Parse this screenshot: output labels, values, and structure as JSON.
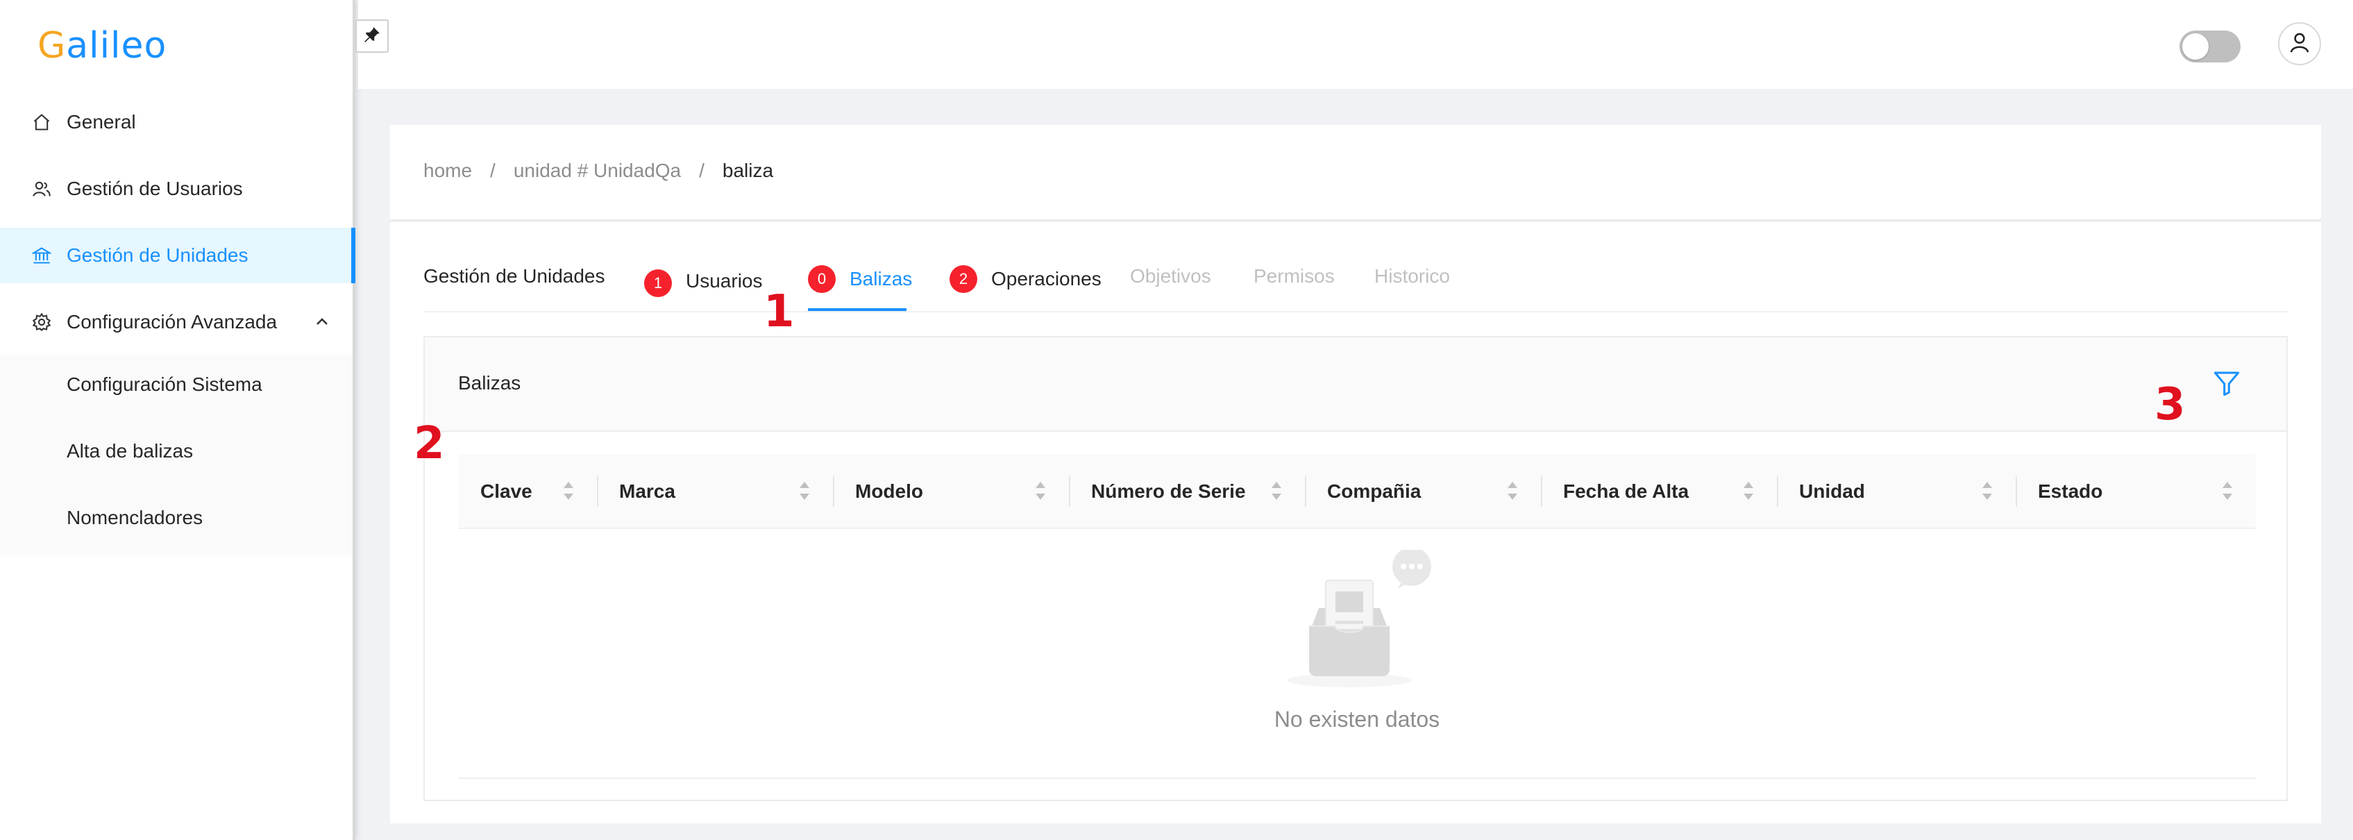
{
  "logo": {
    "first": "G",
    "rest": "alileo"
  },
  "sidebar": {
    "items": [
      {
        "label": "General",
        "icon": "home-icon"
      },
      {
        "label": "Gestión de Usuarios",
        "icon": "users-icon"
      },
      {
        "label": "Gestión de Unidades",
        "icon": "bank-icon",
        "active": true
      },
      {
        "label": "Configuración Avanzada",
        "icon": "gear-icon",
        "expanded": true
      }
    ],
    "submenu": [
      {
        "label": "Configuración Sistema"
      },
      {
        "label": "Alta de balizas"
      },
      {
        "label": "Nomencladores"
      }
    ]
  },
  "header": {
    "pin_icon": "pin-icon",
    "theme_toggle": false,
    "user_icon": "user-icon"
  },
  "breadcrumb": {
    "items": [
      "home",
      "unidad # UnidadQa",
      "baliza"
    ],
    "separator": "/"
  },
  "tabs": [
    {
      "label": "Gestión de Unidades"
    },
    {
      "label": "Usuarios",
      "badge": "1"
    },
    {
      "label": "Balizas",
      "badge": "0",
      "active": true
    },
    {
      "label": "Operaciones",
      "badge": "2"
    },
    {
      "label": "Objetivos",
      "disabled": true
    },
    {
      "label": "Permisos",
      "disabled": true
    },
    {
      "label": "Historico",
      "disabled": true
    }
  ],
  "panel": {
    "title": "Balizas",
    "columns": [
      "Clave",
      "Marca",
      "Modelo",
      "Número de Serie",
      "Compañia",
      "Fecha de Alta",
      "Unidad",
      "Estado"
    ],
    "empty_text": "No existen datos"
  },
  "annotations": [
    "1",
    "2",
    "3"
  ],
  "colors": {
    "primary": "#1890ff",
    "badge": "#f5222d",
    "annotation": "#e0101f",
    "logo_g": "#f5a623"
  }
}
